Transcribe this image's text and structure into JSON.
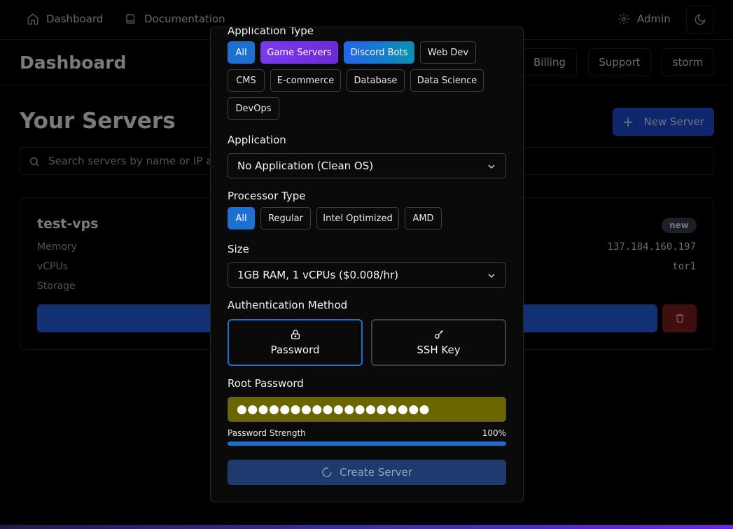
{
  "topnav": {
    "dashboard": "Dashboard",
    "documentation": "Documentation",
    "admin": "Admin"
  },
  "header": {
    "title": "Dashboard",
    "buttons": [
      "Billing",
      "Support",
      "storm"
    ]
  },
  "main": {
    "title": "Your Servers",
    "new_server": "New Server",
    "search_placeholder": "Search servers by name or IP address..."
  },
  "server": {
    "name": "test-vps",
    "badge": "new",
    "memory_label": "Memory",
    "vcpus_label": "vCPUs",
    "storage_label": "Storage",
    "ip": "137.184.160.197",
    "region": "tor1"
  },
  "modal": {
    "app_type_label": "Application Type",
    "app_types": [
      "All",
      "Game Servers",
      "Discord Bots",
      "Web Dev",
      "CMS",
      "E-commerce",
      "Database",
      "Data Science",
      "DevOps"
    ],
    "application_label": "Application",
    "application_value": "No Application (Clean OS)",
    "processor_label": "Processor Type",
    "processors": [
      "All",
      "Regular",
      "Intel Optimized",
      "AMD"
    ],
    "size_label": "Size",
    "size_value": "1GB RAM, 1 vCPUs ($0.008/hr)",
    "auth_label": "Authentication Method",
    "auth_password": "Password",
    "auth_ssh": "SSH Key",
    "root_password_label": "Root Password",
    "root_password_value": "●●●●●●●●●●●●●●●●●●",
    "strength_label": "Password Strength",
    "strength_value": "100%",
    "strength_fraction": 1.0,
    "create_button": "Create Server"
  },
  "colors": {
    "accent": "#1d6fd0",
    "password_field": "#6b6600"
  }
}
